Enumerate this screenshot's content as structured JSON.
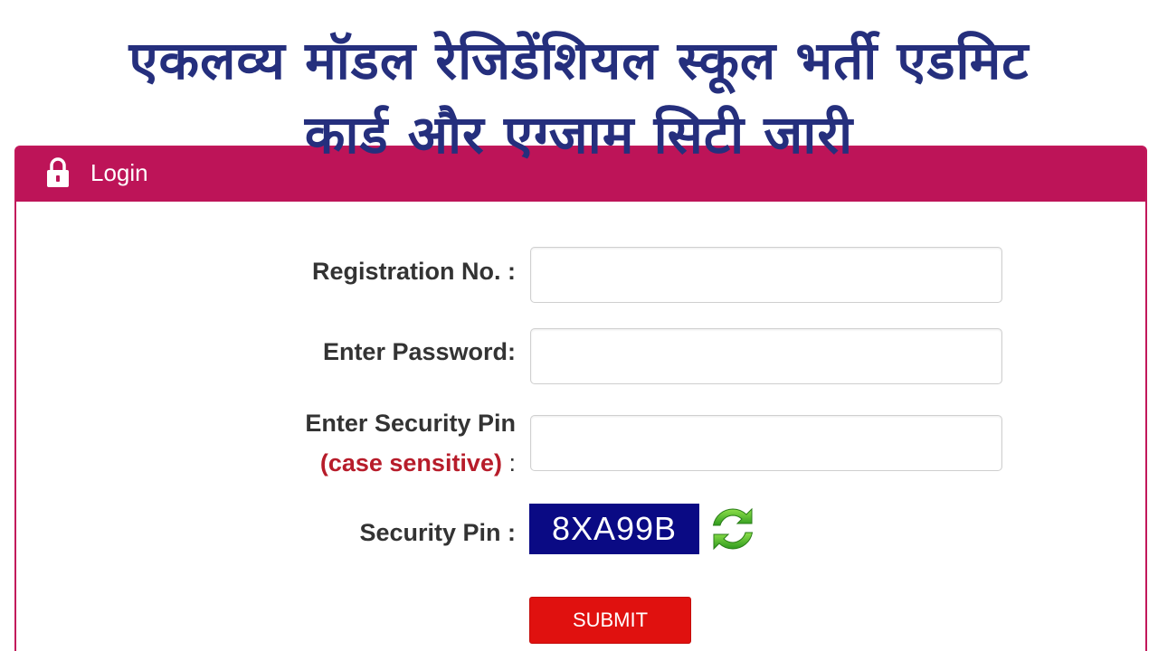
{
  "headline": {
    "line1": "एकलव्य मॉडल रेजिडेंशियल स्कूल भर्ती एडमिट",
    "line2": "कार्ड और एग्जाम सिटी जारी"
  },
  "panel": {
    "title": "Login",
    "icon": "lock-icon",
    "header_color": "#bd1458"
  },
  "form": {
    "registration_label": "Registration No. :",
    "password_label": "Enter Password:",
    "security_pin_label": "Enter Security Pin",
    "case_hint": "(case sensitive)",
    "case_hint_colon": ":",
    "captcha_label": "Security Pin :",
    "captcha_value": "8XA99B",
    "registration_value": "",
    "password_value": "",
    "security_pin_value": "",
    "refresh_icon": "refresh-icon",
    "submit_label": "SUBMIT"
  },
  "colors": {
    "headline": "#252f7d",
    "submit": "#e0110f",
    "captcha_bg": "#0a0a84",
    "hint": "#b71c2a"
  }
}
